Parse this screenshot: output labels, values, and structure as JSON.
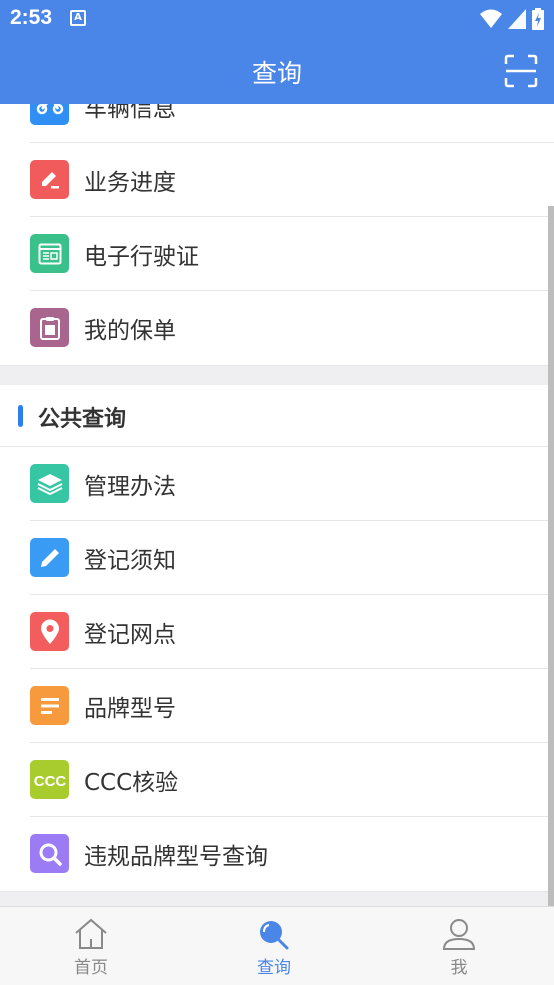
{
  "status_bar": {
    "time": "2:53",
    "notification_icon": "A"
  },
  "app_bar": {
    "title": "查询",
    "scan_icon": "scan-icon"
  },
  "personal_items": [
    {
      "label": "车辆信息",
      "icon": "motorcycle-icon",
      "color": "#2f8ff5"
    },
    {
      "label": "业务进度",
      "icon": "edit-icon",
      "color": "#f15b5b"
    },
    {
      "label": "电子行驶证",
      "icon": "license-icon",
      "color": "#3ac08a"
    },
    {
      "label": "我的保单",
      "icon": "policy-icon",
      "color": "#a8658e"
    }
  ],
  "public_section": {
    "title": "公共查询",
    "items": [
      {
        "label": "管理办法",
        "icon": "layers-icon",
        "color": "#36c6a4"
      },
      {
        "label": "登记须知",
        "icon": "pencil-icon",
        "color": "#3a9bf5"
      },
      {
        "label": "登记网点",
        "icon": "location-icon",
        "color": "#f35d5d"
      },
      {
        "label": "品牌型号",
        "icon": "list-icon",
        "color": "#f79a3e"
      },
      {
        "label": "CCC核验",
        "icon": "ccc-icon",
        "color": "#a8cc2e"
      },
      {
        "label": "违规品牌型号查询",
        "icon": "search-icon",
        "color": "#9b7cf4"
      }
    ]
  },
  "tab_bar": {
    "tabs": [
      {
        "label": "首页",
        "icon": "home-icon",
        "active": false
      },
      {
        "label": "查询",
        "icon": "query-icon",
        "active": true
      },
      {
        "label": "我",
        "icon": "user-icon",
        "active": false
      }
    ],
    "active_color": "#4a86e8"
  }
}
